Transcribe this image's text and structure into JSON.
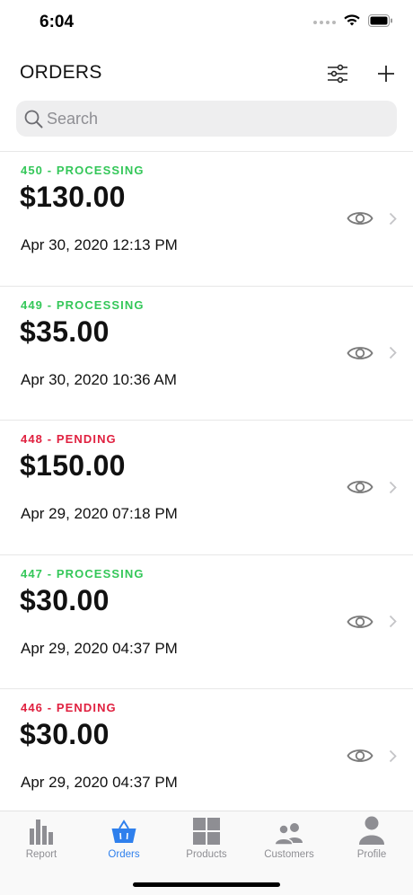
{
  "status_bar": {
    "time": "6:04"
  },
  "header": {
    "title": "ORDERS",
    "filter_icon": "sliders-icon",
    "add_icon": "plus-icon"
  },
  "search": {
    "placeholder": "Search",
    "value": ""
  },
  "orders": [
    {
      "status_line": "450 - PROCESSING",
      "status": "processing",
      "amount": "$130.00",
      "date": "Apr 30, 2020 12:13 PM"
    },
    {
      "status_line": "449 - PROCESSING",
      "status": "processing",
      "amount": "$35.00",
      "date": "Apr 30, 2020 10:36 AM"
    },
    {
      "status_line": "448 - PENDING",
      "status": "pending",
      "amount": "$150.00",
      "date": "Apr 29, 2020 07:18 PM"
    },
    {
      "status_line": "447 - PROCESSING",
      "status": "processing",
      "amount": "$30.00",
      "date": "Apr 29, 2020 04:37 PM"
    },
    {
      "status_line": "446 - PENDING",
      "status": "pending",
      "amount": "$30.00",
      "date": "Apr 29, 2020 04:37 PM"
    }
  ],
  "tabs": [
    {
      "label": "Report",
      "icon": "bar-chart-icon",
      "active": false
    },
    {
      "label": "Orders",
      "icon": "basket-icon",
      "active": true
    },
    {
      "label": "Products",
      "icon": "grid-icon",
      "active": false
    },
    {
      "label": "Customers",
      "icon": "people-icon",
      "active": false
    },
    {
      "label": "Profile",
      "icon": "person-icon",
      "active": false
    }
  ],
  "colors": {
    "processing": "#34c759",
    "pending": "#e0203f",
    "accent": "#2f80ed",
    "tab_inactive": "#8e8e93"
  }
}
